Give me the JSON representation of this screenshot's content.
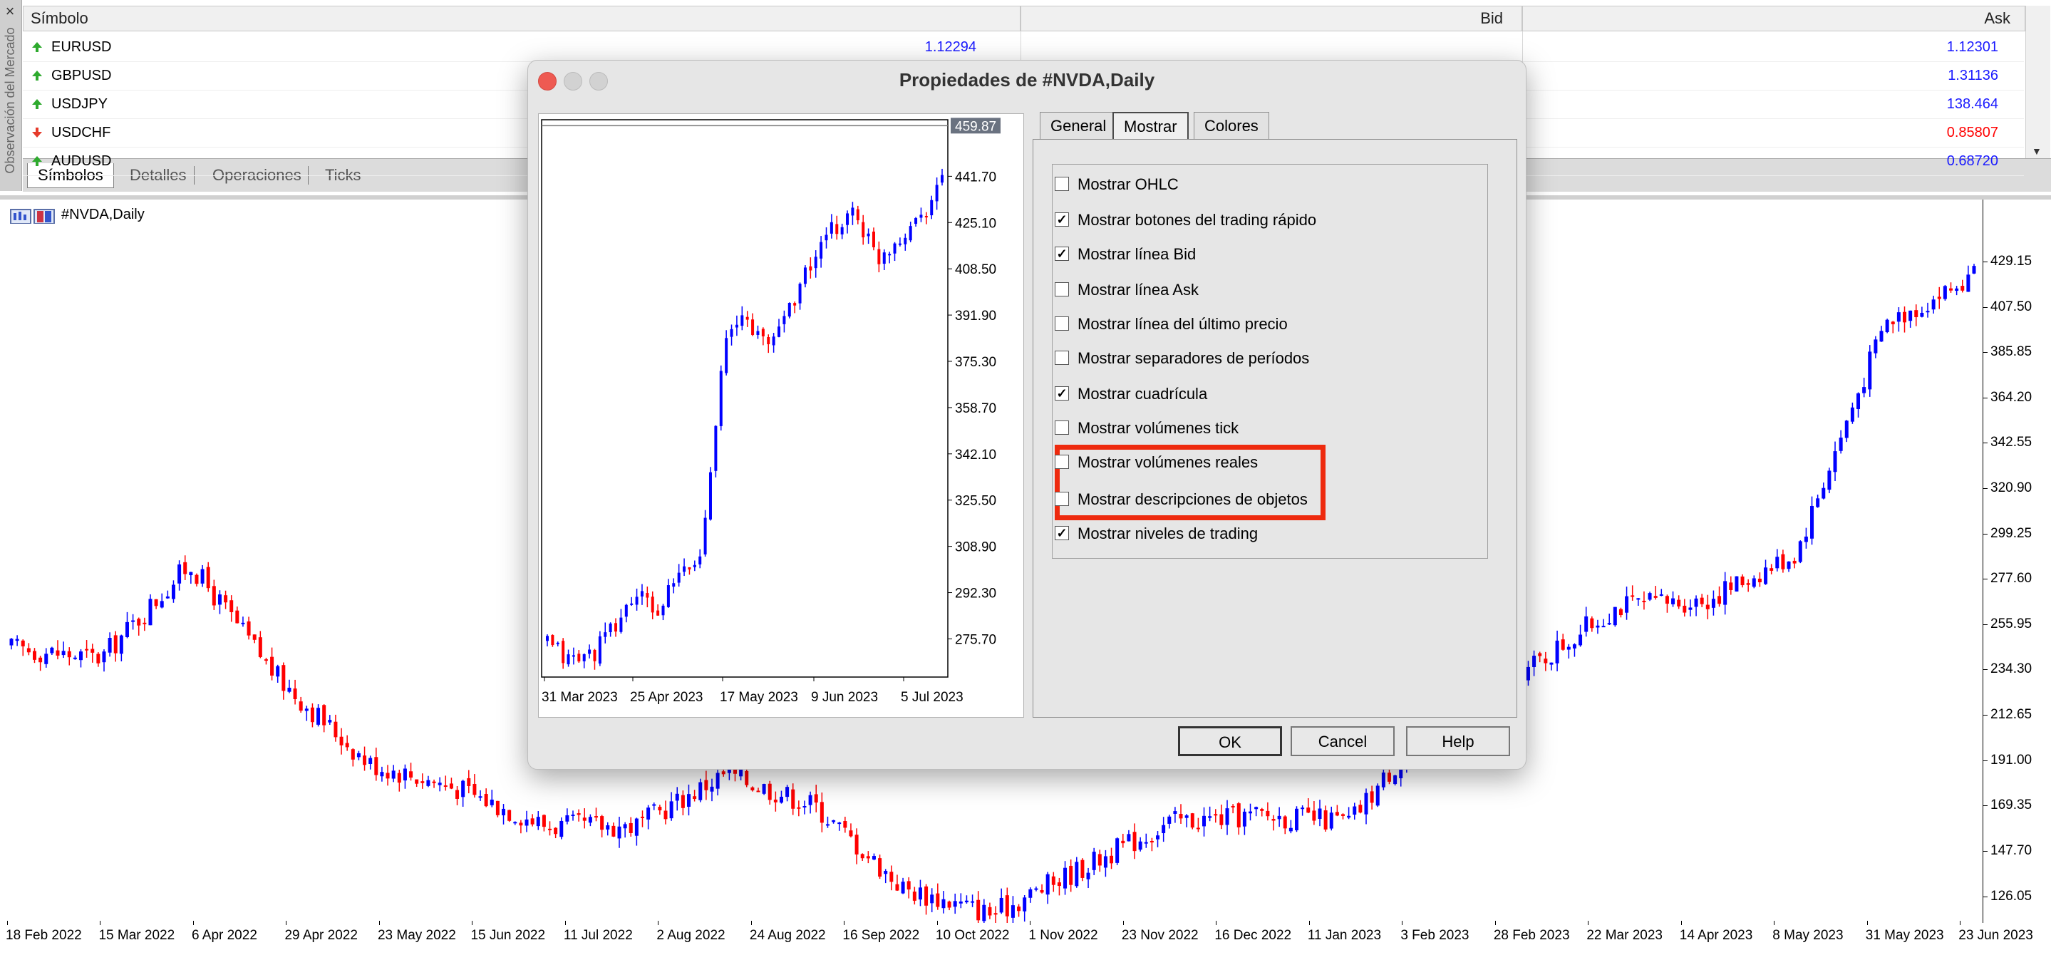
{
  "market_watch": {
    "side_title": "Observación del Mercado",
    "columns": [
      "Símbolo",
      "Bid",
      "Ask"
    ],
    "rows": [
      {
        "symbol": "EURUSD",
        "bid": "1.12294",
        "ask": "1.12301",
        "dir": "up"
      },
      {
        "symbol": "GBPUSD",
        "bid": "",
        "ask": "1.31136",
        "dir": "up"
      },
      {
        "symbol": "USDJPY",
        "bid": "",
        "ask": "138.464",
        "dir": "up"
      },
      {
        "symbol": "USDCHF",
        "bid": "",
        "ask": "0.85807",
        "dir": "down"
      },
      {
        "symbol": "AUDUSD",
        "bid": "",
        "ask": "0.68720",
        "dir": "up"
      }
    ],
    "tabs": [
      "Símbolos",
      "Detalles",
      "Operaciones",
      "Ticks"
    ],
    "colors": {
      "up": "#2eaa2e",
      "down": "#e53a2a",
      "bid": "#1a1aff",
      "ask_down": "#ff0000"
    }
  },
  "chart": {
    "title": "#NVDA,Daily",
    "y_ticks": [
      "429.15",
      "407.50",
      "385.85",
      "364.20",
      "342.55",
      "320.90",
      "299.25",
      "277.60",
      "255.95",
      "234.30",
      "212.65",
      "191.00",
      "169.35",
      "147.70",
      "126.05"
    ],
    "x_ticks": [
      "18 Feb 2022",
      "15 Mar 2022",
      "6 Apr 2022",
      "29 Apr 2022",
      "23 May 2022",
      "15 Jun 2022",
      "11 Jul 2022",
      "2 Aug 2022",
      "24 Aug 2022",
      "16 Sep 2022",
      "10 Oct 2022",
      "1 Nov 2022",
      "23 Nov 2022",
      "16 Dec 2022",
      "11 Jan 2023",
      "3 Feb 2023",
      "28 Feb 2023",
      "22 Mar 2023",
      "14 Apr 2023",
      "8 May 2023",
      "31 May 2023",
      "23 Jun 2023"
    ],
    "colors": {
      "bull": "#0000ff",
      "bear": "#ff0000"
    }
  },
  "chart_data": {
    "type": "candlestick",
    "title": "#NVDA,Daily",
    "xlabel": "",
    "ylabel": "",
    "x_range": [
      "18 Feb 2022",
      "Jul 2023"
    ],
    "ylim": [
      115,
      440
    ],
    "grid": false,
    "approx_close_path": [
      {
        "x": "18 Feb 2022",
        "y": 245
      },
      {
        "x": "15 Mar 2022",
        "y": 240
      },
      {
        "x": "29 Mar 2022",
        "y": 285
      },
      {
        "x": "6 Apr 2022",
        "y": 230
      },
      {
        "x": "29 Apr 2022",
        "y": 190
      },
      {
        "x": "23 May 2022",
        "y": 178
      },
      {
        "x": "15 Jun 2022",
        "y": 160
      },
      {
        "x": "11 Jul 2022",
        "y": 160
      },
      {
        "x": "2 Aug 2022",
        "y": 185
      },
      {
        "x": "24 Aug 2022",
        "y": 170
      },
      {
        "x": "16 Sep 2022",
        "y": 130
      },
      {
        "x": "10 Oct 2022",
        "y": 118
      },
      {
        "x": "1 Nov 2022",
        "y": 140
      },
      {
        "x": "23 Nov 2022",
        "y": 162
      },
      {
        "x": "16 Dec 2022",
        "y": 165
      },
      {
        "x": "11 Jan 2023",
        "y": 162
      },
      {
        "x": "3 Feb 2023",
        "y": 215
      },
      {
        "x": "28 Feb 2023",
        "y": 235
      },
      {
        "x": "22 Mar 2023",
        "y": 265
      },
      {
        "x": "14 Apr 2023",
        "y": 268
      },
      {
        "x": "8 May 2023",
        "y": 290
      },
      {
        "x": "31 May 2023",
        "y": 400
      },
      {
        "x": "23 Jun 2023",
        "y": 422
      }
    ]
  },
  "dialog": {
    "title": "Propiedades de #NVDA,Daily",
    "tabs": [
      "General",
      "Mostrar",
      "Colores"
    ],
    "active_tab": "Mostrar",
    "options": [
      {
        "label": "Mostrar OHLC",
        "checked": false
      },
      {
        "label": "Mostrar botones del trading rápido",
        "checked": true
      },
      {
        "label": "Mostrar línea Bid",
        "checked": true
      },
      {
        "label": "Mostrar línea Ask",
        "checked": false
      },
      {
        "label": "Mostrar línea del último precio",
        "checked": false
      },
      {
        "label": "Mostrar separadores de períodos",
        "checked": false
      },
      {
        "label": "Mostrar cuadrícula",
        "checked": true
      },
      {
        "label": "Mostrar volúmenes tick",
        "checked": false
      },
      {
        "label": "Mostrar volúmenes reales",
        "checked": false
      },
      {
        "label": "Mostrar descripciones de objetos",
        "checked": false
      },
      {
        "label": "Mostrar niveles de trading",
        "checked": true
      }
    ],
    "buttons": {
      "ok": "OK",
      "cancel": "Cancel",
      "help": "Help"
    },
    "highlight_color": "#ee2a0e",
    "preview": {
      "current_price": "459.87",
      "y_ticks": [
        "441.70",
        "425.10",
        "408.50",
        "391.90",
        "375.30",
        "358.70",
        "342.10",
        "325.50",
        "308.90",
        "292.30",
        "275.70"
      ],
      "x_ticks": [
        "31 Mar 2023",
        "25 Apr 2023",
        "17 May 2023",
        "9 Jun 2023",
        "5 Jul 2023"
      ]
    }
  }
}
